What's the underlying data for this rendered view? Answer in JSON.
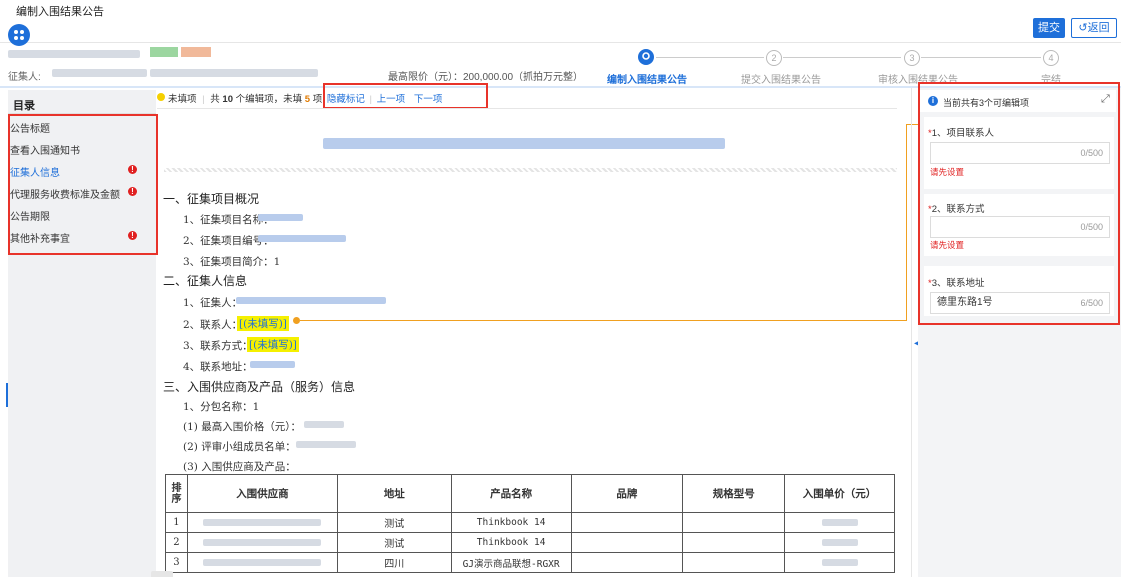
{
  "header": {
    "title": "编制入围结果公告",
    "submit_label": "提交",
    "back_label": "返回",
    "collector_label": "征集人:",
    "max_price_text": "最高限价（元）：200,000.00（抓拍万元整）"
  },
  "steps": [
    {
      "num": "",
      "label": "编制入围结果公告"
    },
    {
      "num": "2",
      "label": "提交入围结果公告"
    },
    {
      "num": "3",
      "label": "审核入围结果公告"
    },
    {
      "num": "4",
      "label": "完结"
    }
  ],
  "toolbar": {
    "unfilled_label": "未填项",
    "summary_prefix": "共",
    "total": "10",
    "summary_mid": "个编辑项，未填",
    "unfilled_count": "5",
    "summary_suffix": "项",
    "hide_marks": "隐藏标记",
    "prev": "上一项",
    "next": "下一项"
  },
  "sidebar": {
    "heading": "目录",
    "items": [
      {
        "label": "公告标题",
        "alert": false
      },
      {
        "label": "查看入围通知书",
        "alert": false
      },
      {
        "label": "征集人信息",
        "alert": true
      },
      {
        "label": "代理服务收费标准及金额",
        "alert": true
      },
      {
        "label": "公告期限",
        "alert": false
      },
      {
        "label": "其他补充事宜",
        "alert": true
      }
    ]
  },
  "document": {
    "sec1": "一、征集项目概况",
    "sec1_items": [
      "1、征集项目名称：",
      "2、征集项目编号：",
      "3、征集项目简介：1"
    ],
    "sec2": "二、征集人信息",
    "sec2_items": [
      "1、征集人：",
      "2、联系人：",
      "3、联系方式：",
      "4、联系地址："
    ],
    "unfilled_tag": "[(未填写)]",
    "sec3": "三、入围供应商及产品（服务）信息",
    "sec3_items": [
      "1、分包名称：1",
      "(1) 最高入围价格（元）：",
      "(2) 评审小组成员名单：",
      "(3) 入围供应商及产品："
    ],
    "table": {
      "headers": [
        "排序",
        "入围供应商",
        "地址",
        "产品名称",
        "品牌",
        "规格型号",
        "入围单价（元）"
      ],
      "rows": [
        {
          "no": "1",
          "addr": "测试",
          "product": "Thinkbook 14"
        },
        {
          "no": "2",
          "addr": "测试",
          "product": "Thinkbook 14"
        },
        {
          "no": "3",
          "addr": "四川",
          "product": "GJ演示商品联想-RGXR"
        }
      ]
    }
  },
  "right_panel": {
    "info": "当前共有3个可编辑项",
    "fields": [
      {
        "label": "1、项目联系人",
        "value": "",
        "count": "0/500",
        "error": "请先设置"
      },
      {
        "label": "2、联系方式",
        "value": "",
        "count": "0/500",
        "error": "请先设置"
      },
      {
        "label": "3、联系地址",
        "value": "德里东路1号",
        "count": "6/500",
        "error": ""
      }
    ]
  },
  "colors": {
    "accent": "#1e6fd9",
    "alert": "#e02020",
    "highlight": "#f5f000",
    "annotation": "#e8332a"
  }
}
